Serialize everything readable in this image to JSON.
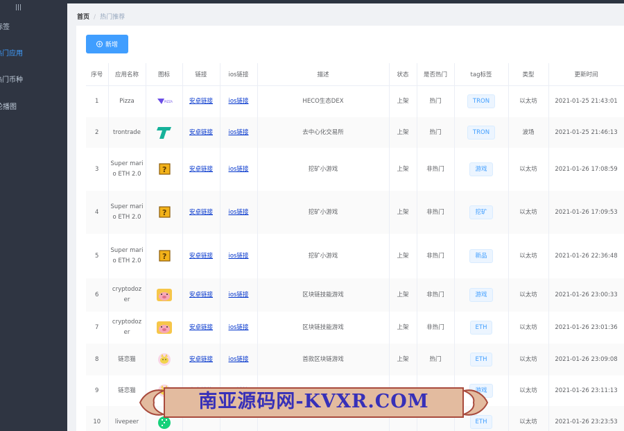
{
  "sidebar": {
    "collapse_icon": "hamburger-icon",
    "items": [
      {
        "label": "标签",
        "active": false
      },
      {
        "label": "热门应用",
        "active": true
      },
      {
        "label": "热门币种",
        "active": false
      },
      {
        "label": "轮播图",
        "active": false
      }
    ]
  },
  "breadcrumb": {
    "home": "首页",
    "current": "热门推荐"
  },
  "toolbar": {
    "add_label": "新增"
  },
  "table": {
    "headers": [
      "序号",
      "应用名称",
      "图标",
      "链接",
      "ios链接",
      "描述",
      "状态",
      "是否热门",
      "tag标签",
      "类型",
      "更新时间"
    ],
    "rows": [
      {
        "no": "1",
        "name": "Pizza",
        "icon": "pizza-logo-icon",
        "link": "安卓链接",
        "ios": "ios链接",
        "desc": "HECO生态DEX",
        "status": "上架",
        "hot": "热门",
        "tag": "TRON",
        "type": "以太坊",
        "time": "2021-01-25 21:43:01"
      },
      {
        "no": "2",
        "name": "trontrade",
        "icon": "trontrade-logo-icon",
        "link": "安卓链接",
        "ios": "ios链接",
        "desc": "去中心化交易所",
        "status": "上架",
        "hot": "热门",
        "tag": "TRON",
        "type": "波场",
        "time": "2021-01-25 21:46:13"
      },
      {
        "no": "3",
        "name": "Super mario ETH 2.0",
        "icon": "question-block-icon",
        "link": "安卓链接",
        "ios": "ios链接",
        "desc": "挖矿小游戏",
        "status": "上架",
        "hot": "非热门",
        "tag": "游戏",
        "type": "以太坊",
        "time": "2021-01-26 17:08:59"
      },
      {
        "no": "4",
        "name": "Super mario ETH 2.0",
        "icon": "question-block-icon",
        "link": "安卓链接",
        "ios": "ios链接",
        "desc": "挖矿小游戏",
        "status": "上架",
        "hot": "非热门",
        "tag": "挖矿",
        "type": "以太坊",
        "time": "2021-01-26 17:09:53"
      },
      {
        "no": "5",
        "name": "Super mario ETH 2.0",
        "icon": "question-block-icon",
        "link": "安卓链接",
        "ios": "ios链接",
        "desc": "挖矿小游戏",
        "status": "上架",
        "hot": "非热门",
        "tag": "新品",
        "type": "以太坊",
        "time": "2021-01-26 22:36:48"
      },
      {
        "no": "6",
        "name": "cryptodozer",
        "icon": "pig-avatar-icon",
        "link": "安卓链接",
        "ios": "ios链接",
        "desc": "区块链技能游戏",
        "status": "上架",
        "hot": "非热门",
        "tag": "游戏",
        "type": "以太坊",
        "time": "2021-01-26 23:00:33"
      },
      {
        "no": "7",
        "name": "cryptodozer",
        "icon": "pig-avatar-icon",
        "link": "安卓链接",
        "ios": "ios链接",
        "desc": "区块链技能游戏",
        "status": "上架",
        "hot": "非热门",
        "tag": "ETH",
        "type": "以太坊",
        "time": "2021-01-26 23:01:36"
      },
      {
        "no": "8",
        "name": "链恋猫",
        "icon": "cat-avatar-icon",
        "link": "安卓链接",
        "ios": "ios链接",
        "desc": "首款区块链游戏",
        "status": "上架",
        "hot": "热门",
        "tag": "ETH",
        "type": "以太坊",
        "time": "2021-01-26 23:09:08"
      },
      {
        "no": "9",
        "name": "链恋猫",
        "icon": "cat-avatar-icon",
        "link": "安卓链接",
        "ios": "ios链接",
        "desc": "",
        "status": "",
        "hot": "",
        "tag": "游戏",
        "type": "以太坊",
        "time": "2021-01-26 23:11:13"
      },
      {
        "no": "10",
        "name": "livepeer",
        "icon": "livepeer-logo-icon",
        "link": "",
        "ios": "",
        "desc": "",
        "status": "",
        "hot": "",
        "tag": "ETH",
        "type": "以太坊",
        "time": "2021-01-26 23:23:53"
      }
    ]
  },
  "watermark": {
    "text": "南亚源码网-KVXR.COM"
  }
}
